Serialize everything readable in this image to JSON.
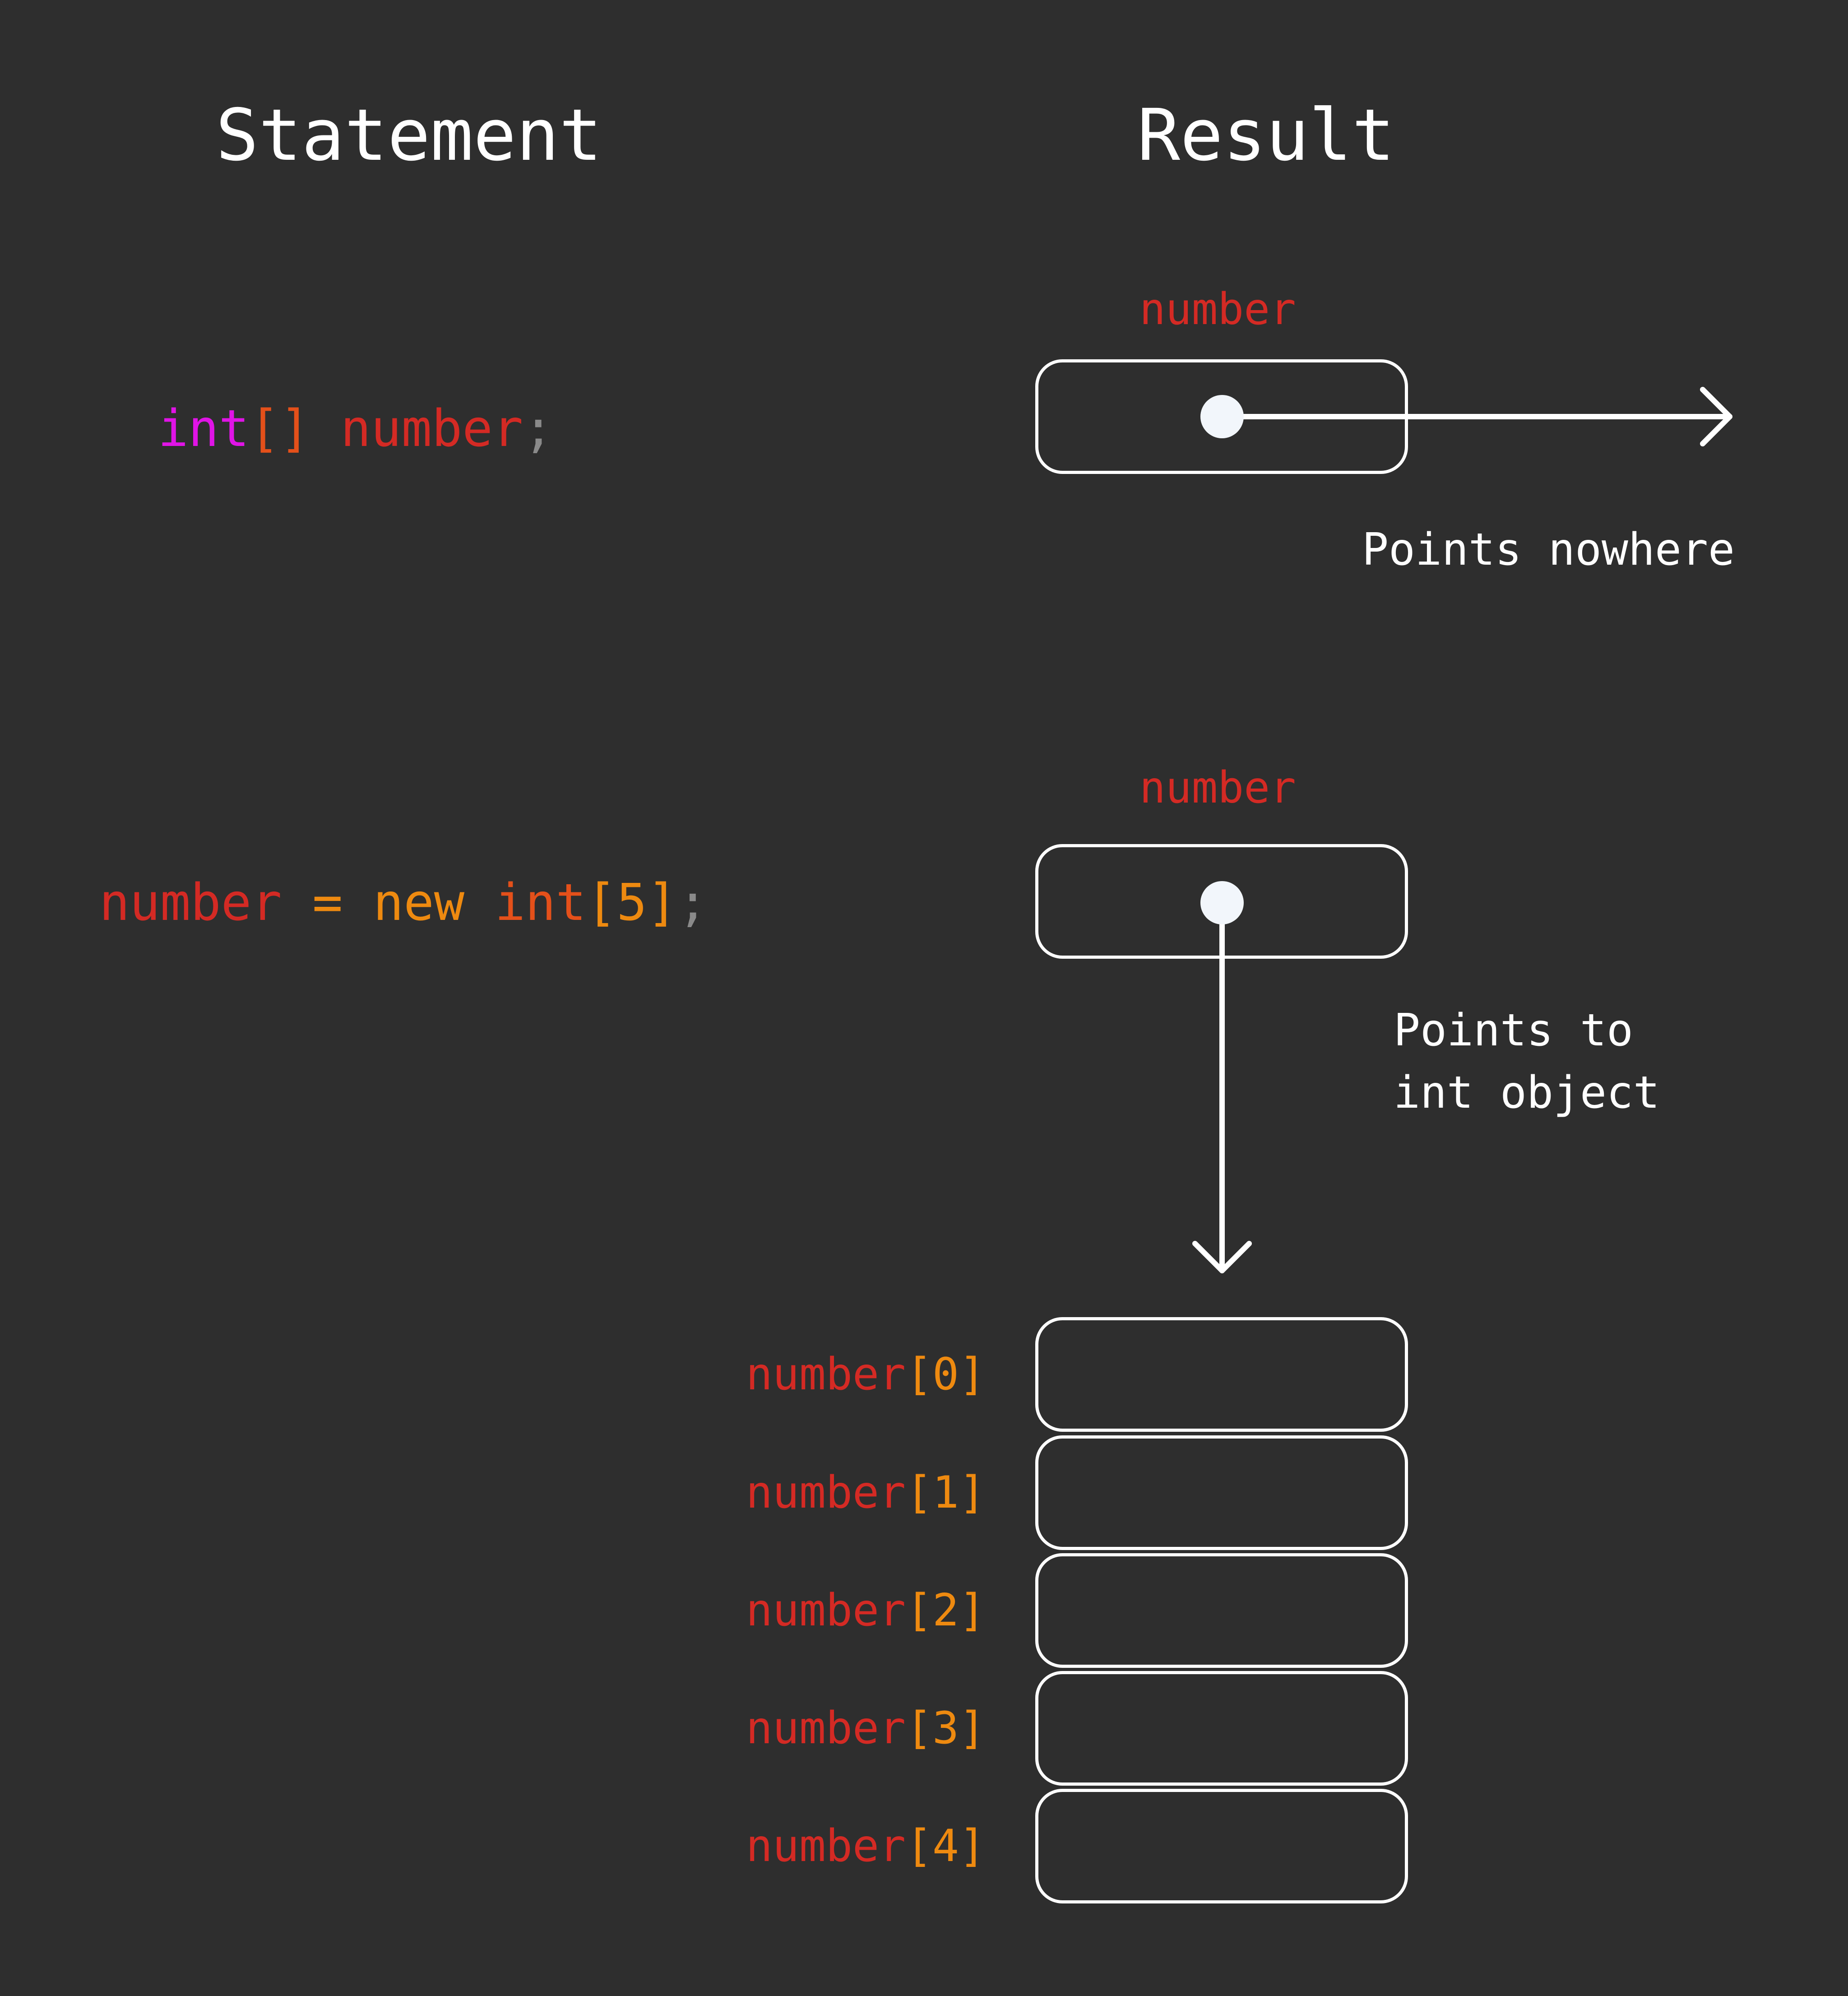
{
  "headers": {
    "statement": "Statement",
    "result": "Result"
  },
  "statement1": {
    "type_kw": "int",
    "brackets": "[]",
    "var": "number",
    "semicolon": ";"
  },
  "statement2": {
    "var": "number",
    "equals": "=",
    "new_kw": "new",
    "type_kw": "int",
    "open_bracket": "[",
    "size": "5",
    "close_bracket": "]",
    "semicolon": ";"
  },
  "result1": {
    "var_label": "number",
    "caption": "Points nowhere"
  },
  "result2": {
    "var_label": "number",
    "caption_line1": "Points to",
    "caption_line2": "int object"
  },
  "elements": [
    {
      "name": "number",
      "open": "[",
      "index": "0",
      "close": "]"
    },
    {
      "name": "number",
      "open": "[",
      "index": "1",
      "close": "]"
    },
    {
      "name": "number",
      "open": "[",
      "index": "2",
      "close": "]"
    },
    {
      "name": "number",
      "open": "[",
      "index": "3",
      "close": "]"
    },
    {
      "name": "number",
      "open": "[",
      "index": "4",
      "close": "]"
    }
  ],
  "colors": {
    "background": "#2e2e2e",
    "identifier": "#d42a24",
    "keyword_type": "#e014e6",
    "keyword_new": "#ee8a10",
    "bracket": "#ee8a10",
    "punctuation": "#8a8a8a",
    "stroke": "#ffffff"
  }
}
